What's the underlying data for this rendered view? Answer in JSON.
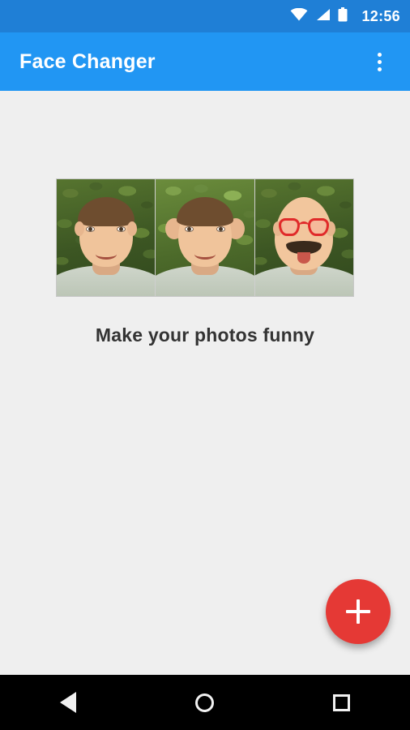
{
  "status_bar": {
    "time": "12:56",
    "icons": [
      "wifi-icon",
      "signal-icon",
      "battery-icon"
    ],
    "background": "#1f7fd6"
  },
  "app_bar": {
    "title": "Face Changer",
    "overflow_label": "More options",
    "background": "#2196f3"
  },
  "main": {
    "preview": {
      "name": "face-filter-preview-strip",
      "frames": [
        {
          "label": "Original face"
        },
        {
          "label": "Big ears face"
        },
        {
          "label": "Bald with glasses and moustache face"
        }
      ]
    },
    "caption": "Make your photos funny"
  },
  "fab": {
    "label": "+",
    "action": "Add photo",
    "color": "#e53935"
  },
  "nav_bar": {
    "buttons": [
      {
        "name": "nav-back-button",
        "label": "Back"
      },
      {
        "name": "nav-home-button",
        "label": "Home"
      },
      {
        "name": "nav-recents-button",
        "label": "Recents"
      }
    ],
    "background": "#000000"
  }
}
